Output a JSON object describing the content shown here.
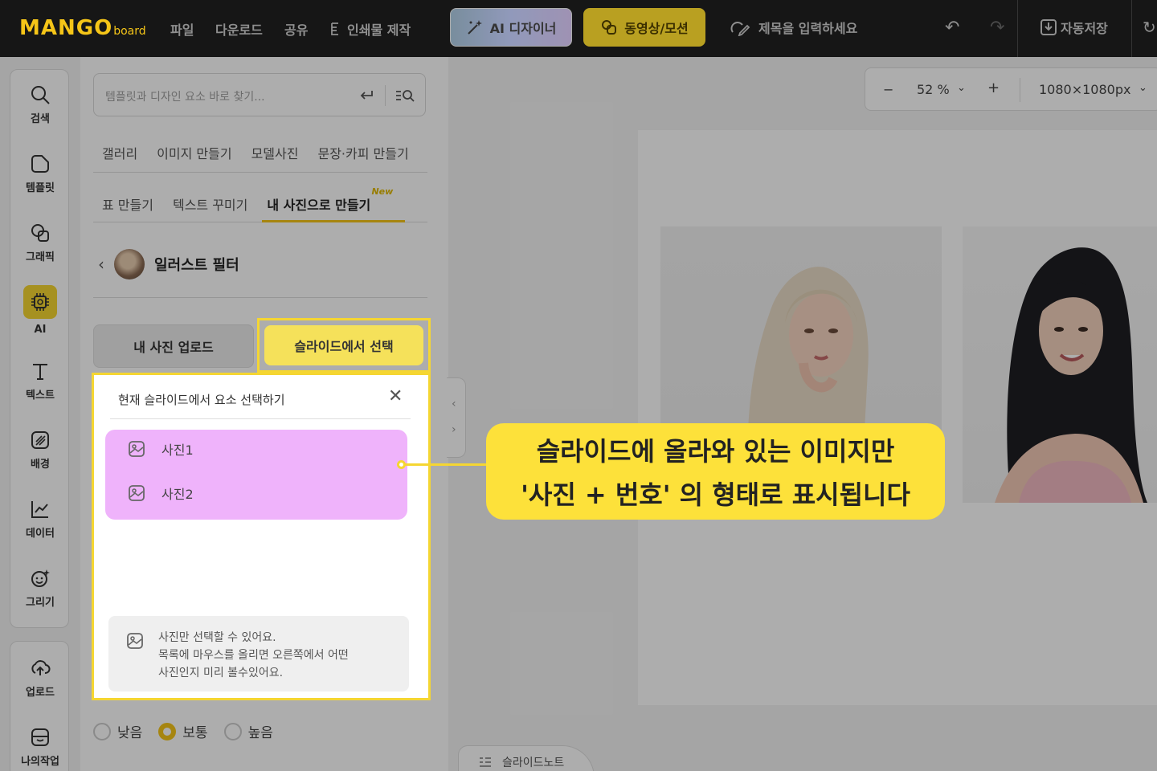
{
  "topbar": {
    "logo_main": "MANGO",
    "logo_sub": "board",
    "menu": [
      "파일",
      "다운로드",
      "공유",
      "인쇄물 제작"
    ],
    "ai_designer": "AI 디자이너",
    "video_motion": "동영상/모션",
    "title_placeholder": "제목을 입력하세요",
    "autosave": "자동저장"
  },
  "rail": {
    "items": [
      "검색",
      "템플릿",
      "그래픽",
      "AI",
      "텍스트",
      "배경",
      "데이터",
      "그리기"
    ],
    "bottom_items": [
      "업로드",
      "나의작업"
    ]
  },
  "panel": {
    "search_placeholder": "템플릿과 디자인 요소 바로 찾기...",
    "categories_row1": [
      "갤러리",
      "이미지 만들기",
      "모델사진",
      "문장·카피 만들기"
    ],
    "categories_row2": [
      "표 만들기",
      "텍스트 꾸미기",
      "내 사진으로 만들기"
    ],
    "new_tag": "New",
    "section_title": "일러스트 필터",
    "upload_button": "내 사진 업로드",
    "slide_select_button": "슬라이드에서 선택",
    "radio_options": [
      "낮음",
      "보통",
      "높음"
    ]
  },
  "popup": {
    "title": "현재 슬라이드에서 요소 선택하기",
    "items": [
      "사진1",
      "사진2"
    ],
    "info_lines": [
      "사진만 선택할 수 있어요.",
      "목록에 마우스를 올리면 오른쪽에서 어떤",
      "사진인지 미리 볼수있어요."
    ]
  },
  "canvas": {
    "zoom": "52 %",
    "size": "1080×1080px"
  },
  "callout": {
    "line1": "슬라이드에 올라와 있는 이미지만",
    "line2": "'사진 + 번호' 의 형태로 표시됩니다"
  },
  "notes_tab": "슬라이드노트",
  "colors": {
    "accent_yellow": "#f5d632",
    "list_highlight": "#efb3fb",
    "topbar_bg": "#161616"
  }
}
